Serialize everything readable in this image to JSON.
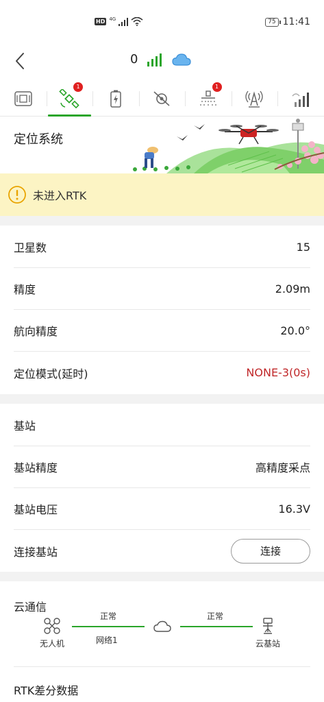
{
  "status_bar": {
    "network": "4G",
    "hd": "HD",
    "battery": "75",
    "time": "11:41"
  },
  "header": {
    "count": "0"
  },
  "tabs": [
    {
      "name": "flight-controller",
      "badge": ""
    },
    {
      "name": "positioning",
      "badge": "1"
    },
    {
      "name": "battery",
      "badge": ""
    },
    {
      "name": "motor",
      "badge": ""
    },
    {
      "name": "spray",
      "badge": "1"
    },
    {
      "name": "radar",
      "badge": ""
    },
    {
      "name": "signal",
      "badge": ""
    }
  ],
  "hero": {
    "title": "定位系统"
  },
  "warning": {
    "text": "未进入RTK"
  },
  "positioning": {
    "satellites_label": "卫星数",
    "satellites_value": "15",
    "accuracy_label": "精度",
    "accuracy_value": "2.09m",
    "heading_label": "航向精度",
    "heading_value": "20.0°",
    "mode_label": "定位模式(延时)",
    "mode_value": "NONE-3(0s)"
  },
  "base_station": {
    "title": "基站",
    "accuracy_label": "基站精度",
    "accuracy_value": "高精度采点",
    "voltage_label": "基站电压",
    "voltage_value": "16.3V",
    "connect_label": "连接基站",
    "connect_button": "连接"
  },
  "cloud_comm": {
    "title": "云通信",
    "left_node": "无人机",
    "right_node": "云基站",
    "left_status": "正常",
    "right_status": "正常",
    "network": "网络1"
  },
  "rtk": {
    "title": "RTK差分数据"
  },
  "colors": {
    "accent": "#2aa52a",
    "warning_bg": "#fcf4c4",
    "error": "#c0282a",
    "badge": "#e02020"
  }
}
